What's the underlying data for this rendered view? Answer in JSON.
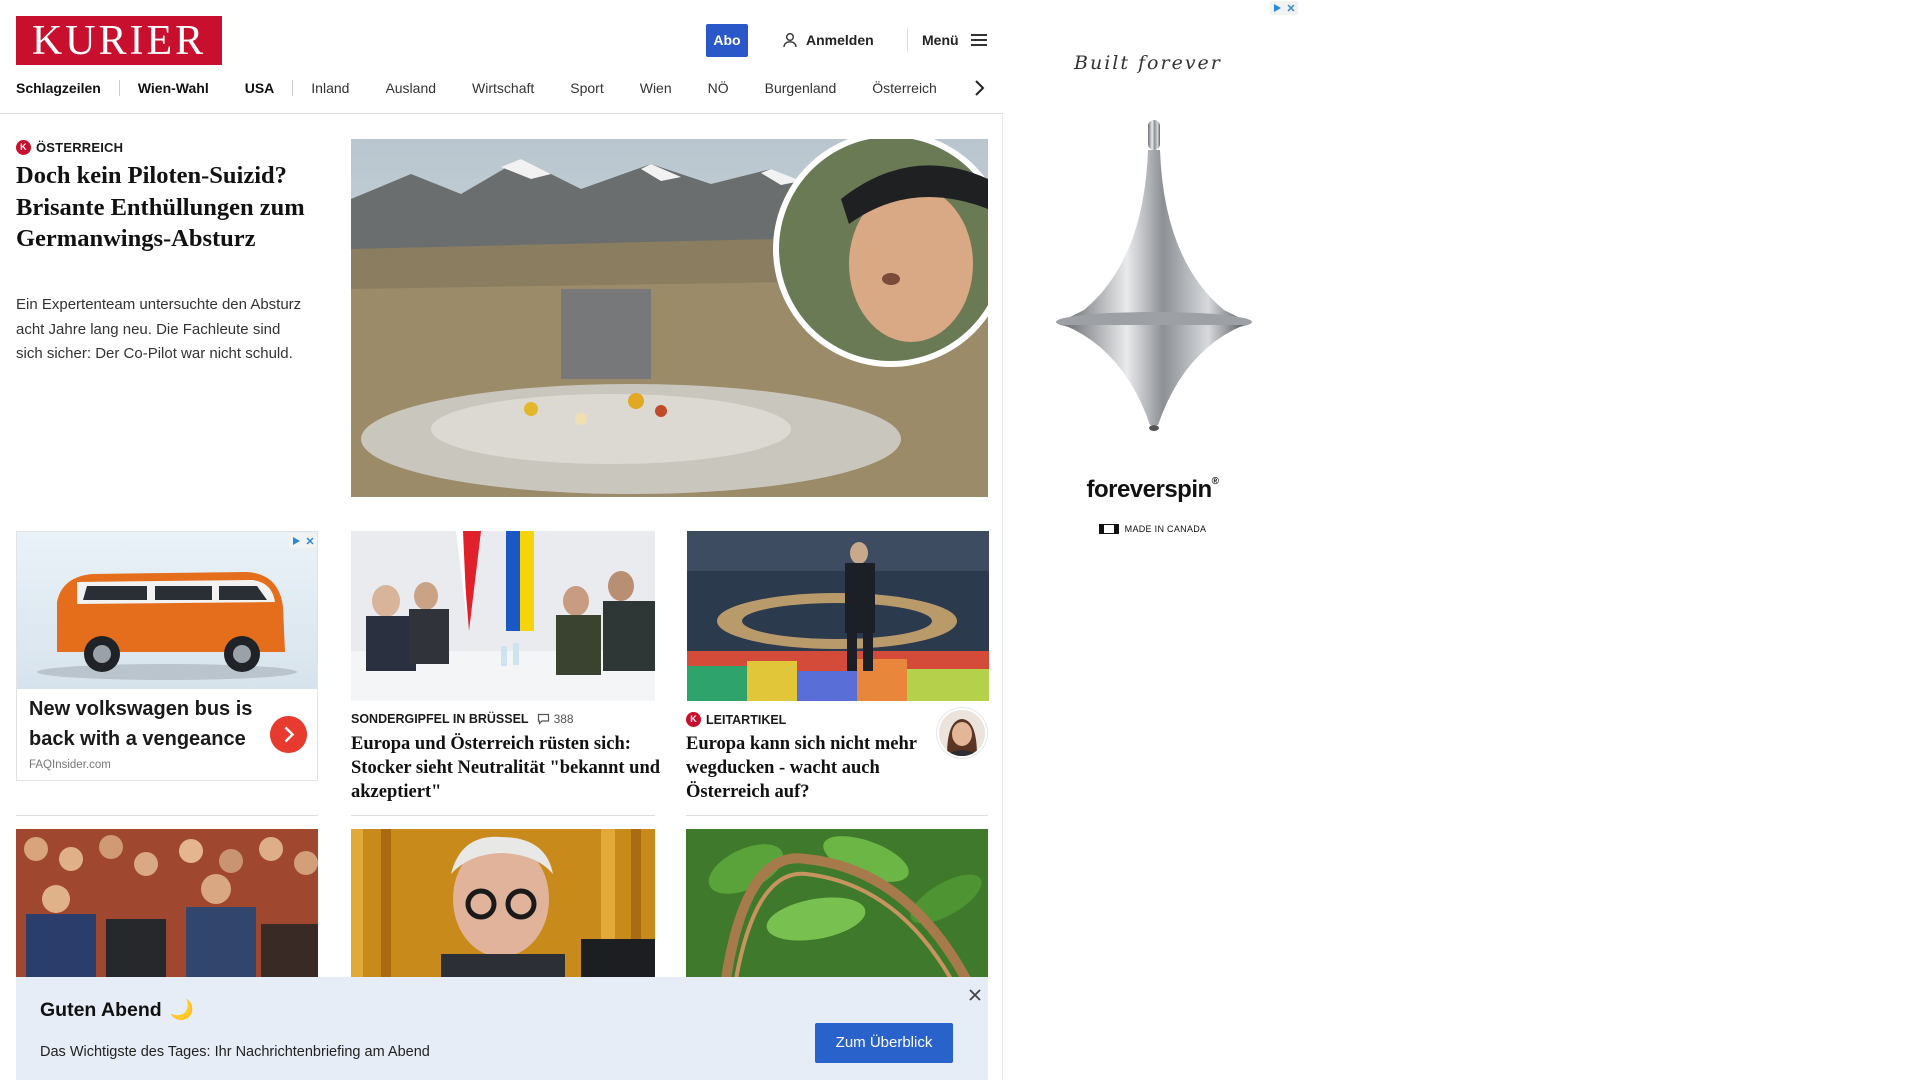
{
  "header": {
    "logo": "KURIER",
    "abo_label": "Abo",
    "login_label": "Anmelden",
    "menu_label": "Menü"
  },
  "nav": {
    "items": [
      "Schlagzeilen",
      "Wien-Wahl",
      "USA",
      "Inland",
      "Ausland",
      "Wirtschaft",
      "Sport",
      "Wien",
      "NÖ",
      "Burgenland",
      "Österreich"
    ]
  },
  "hero": {
    "kicker": "Österreich",
    "title": "Doch kein Piloten-Suizid? Brisante Enthüllungen zum Germanwings-Absturz",
    "description": "Ein Expertenteam untersuchte den Absturz acht Jahre lang neu. Die Fachleute sind sich sicher: Der Co-Pilot war nicht schuld."
  },
  "ad_card": {
    "title": "New volkswagen bus is back with a vengeance",
    "source": "FAQInsider.com"
  },
  "articles": [
    {
      "kicker": "Sondergipfel in Brüssel",
      "comments": "388",
      "title": "Europa und Österreich rüsten sich: Stocker sieht Neutralität \"bekannt und akzeptiert\""
    },
    {
      "kicker": "Leitartikel",
      "title": "Europa kann sich nicht mehr wegducken - wacht auch Österreich auf?"
    }
  ],
  "banner": {
    "title": "Guten Abend",
    "emoji": "🌙",
    "subtitle": "Das Wichtigste des Tages: Ihr Nachrichtenbriefing am Abend",
    "button": "Zum Überblick"
  },
  "side_ad": {
    "tagline": "Built forever",
    "brand": "foreverspin",
    "brand_mark": "®",
    "made_in": "MADE IN CANADA"
  },
  "colors": {
    "brand_red": "#c8102e",
    "accent_blue": "#2a58c9",
    "banner_bg": "#e7edf6"
  }
}
